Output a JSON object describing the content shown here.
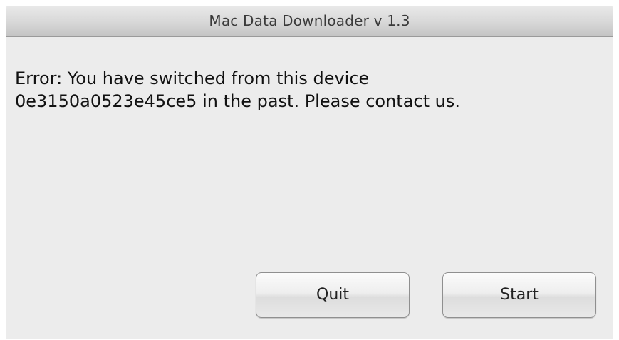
{
  "window": {
    "title": "Mac Data Downloader v 1.3"
  },
  "message": {
    "line1": "Error: You have switched from this device",
    "line2": "0e3150a0523e45ce5 in the past. Please contact us."
  },
  "buttons": {
    "quit_label": "Quit",
    "start_label": "Start"
  }
}
